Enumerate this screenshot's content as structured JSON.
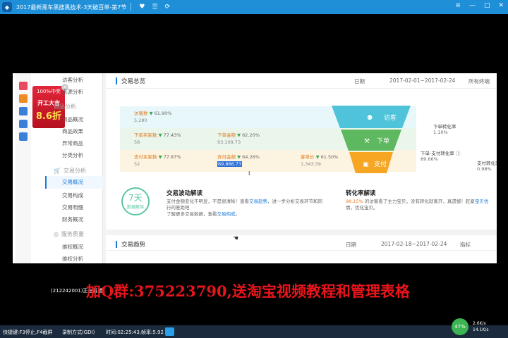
{
  "player": {
    "title": "2017最新黑车黑搜黑技术-3天破百单-第7节",
    "logo": "◆",
    "icons": [
      "heart-icon",
      "list-icon",
      "share-icon"
    ],
    "window_buttons": [
      "≡",
      "—",
      "□",
      "✕"
    ]
  },
  "sidebar": {
    "items": [
      {
        "label": "访客分析"
      },
      {
        "label": "来源分析"
      },
      {
        "label": "商品分析",
        "header": true
      },
      {
        "label": "商品概况"
      },
      {
        "label": "商品效果"
      },
      {
        "label": "异常商品"
      },
      {
        "label": "分类分析"
      },
      {
        "label": "交易分析",
        "header": true
      },
      {
        "label": "交易概况",
        "active": true
      },
      {
        "label": "交易构成"
      },
      {
        "label": "交易明细"
      },
      {
        "label": "财务概况"
      },
      {
        "label": "服务质量",
        "header": true
      },
      {
        "label": "维权概况"
      },
      {
        "label": "维权分析"
      }
    ],
    "promo": {
      "line1": "100%中奖",
      "line2": "开工大吉",
      "line3": "8.6折"
    }
  },
  "overview": {
    "title": "交易总览",
    "date_label": "日期",
    "date_range": "2017-02-01~2017-02-24",
    "terminal": "所有终端",
    "row1": {
      "visitors_label": "访客数",
      "visitors_change": "61.90%",
      "visitors_value": "5,280"
    },
    "row2": {
      "buyers_label": "下单买家数",
      "buyers_change": "77.43%",
      "buyers_value": "58",
      "amount_label": "下单金额",
      "amount_change": "62.20%",
      "amount_value": "93,109.73"
    },
    "row3": {
      "pay_buyers_label": "支付买家数",
      "pay_buyers_change": "77.87%",
      "pay_buyers_value": "52",
      "pay_amount_label": "支付金额",
      "pay_amount_change": "64.26%",
      "pay_amount_value": "69,866.73",
      "aov_label": "客单价",
      "aov_change": "61.50%",
      "aov_value": "1,343.59"
    },
    "funnel": {
      "visitors": "访客",
      "order": "下单",
      "pay": "支付"
    },
    "rates": {
      "order_rate_label": "下单转化率",
      "order_rate_value": "1.10%",
      "order_pay_label": "下单-支付转化率",
      "order_pay_value": "89.66%",
      "pay_rate_label": "支付转化率",
      "pay_rate_value": "0.98%"
    },
    "badge": {
      "number": "7天",
      "text": "数据解读"
    },
    "wave": {
      "title": "交易波动解读",
      "line1": "支付金额变化不明显，不是很清晰！查看",
      "link1": "交易趋势",
      "line1b": "，进一步分析交易环节和同",
      "line2": "行的差距吧",
      "line3": "了解更多交易数据，查看",
      "link2": "交易构成",
      "line3b": "。"
    },
    "conversion": {
      "title": "转化率解读",
      "pct": "98.15%",
      "line1": "的访客看了主力宝贝，没有转化就离开，真遗憾！赶紧",
      "link": "宝贝优",
      "line2": "情，优化宝贝。"
    }
  },
  "trend": {
    "title": "交易趋势",
    "date_label": "日期",
    "date_range": "2017-02-18~2017-02-24",
    "metric": "指标"
  },
  "overlay": {
    "tag": "(212242001)正在直播",
    "qq_text": "加Q群:375223790,送淘宝视频教程和管理表格"
  },
  "status": {
    "shortcuts": "快捷键:F3停止,F4截屏",
    "mode": "录制方式(GDI)",
    "time": "时间:02:25:43,帧率:5.92",
    "cpu": "47%",
    "up": "2.6K/s",
    "down": "14.1K/s"
  }
}
